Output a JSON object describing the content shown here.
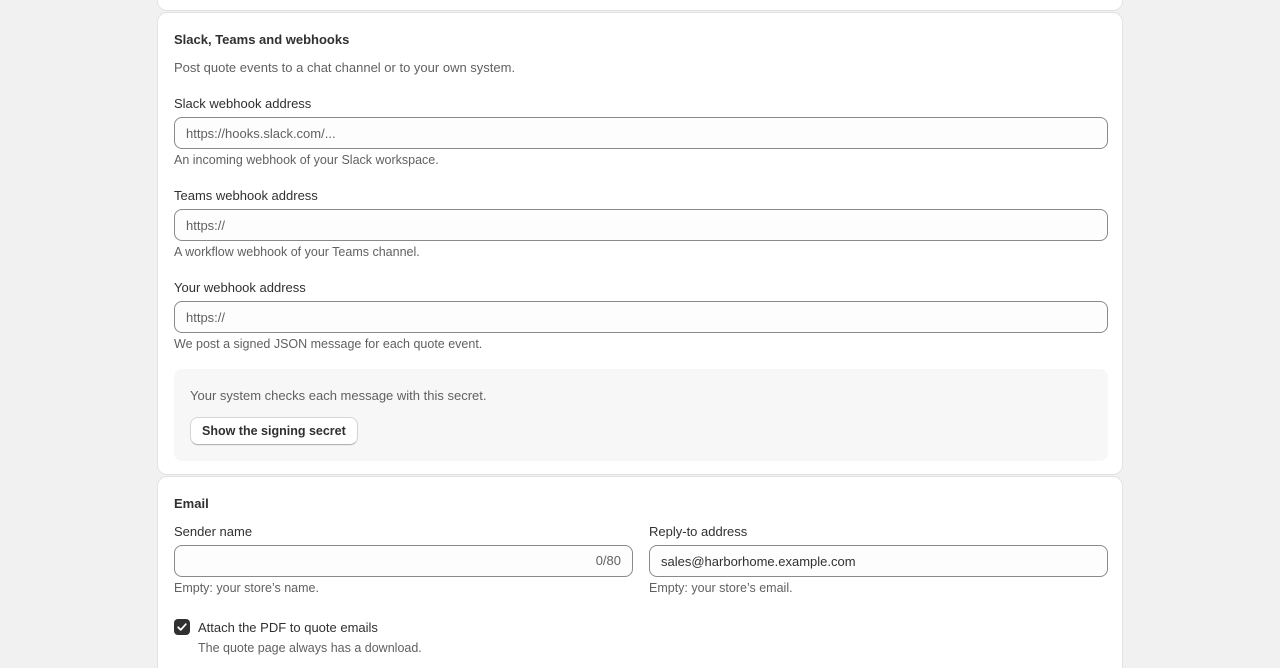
{
  "webhooks": {
    "title": "Slack, Teams and webhooks",
    "description": "Post quote events to a chat channel or to your own system.",
    "slack": {
      "label": "Slack webhook address",
      "placeholder": "https://hooks.slack.com/...",
      "value": "",
      "help": "An incoming webhook of your Slack workspace."
    },
    "teams": {
      "label": "Teams webhook address",
      "placeholder": "https://",
      "value": "",
      "help": "A workflow webhook of your Teams channel."
    },
    "custom": {
      "label": "Your webhook address",
      "placeholder": "https://",
      "value": "",
      "help": "We post a signed JSON message for each quote event."
    },
    "secret": {
      "text": "Your system checks each message with this secret.",
      "button_label": "Show the signing secret"
    }
  },
  "email": {
    "title": "Email",
    "sender": {
      "label": "Sender name",
      "value": "",
      "counter": "0/80",
      "help": "Empty: your store’s name."
    },
    "reply_to": {
      "label": "Reply-to address",
      "value": "sales@harborhome.example.com",
      "help": "Empty: your store’s email."
    },
    "attach_pdf": {
      "label": "Attach the PDF to quote emails",
      "checked": true,
      "help": "The quote page always has a download."
    }
  },
  "colors": {
    "background": "#f1f1f1",
    "card": "#ffffff",
    "text": "#303030",
    "muted": "#616161",
    "checkbox": "#303030"
  }
}
